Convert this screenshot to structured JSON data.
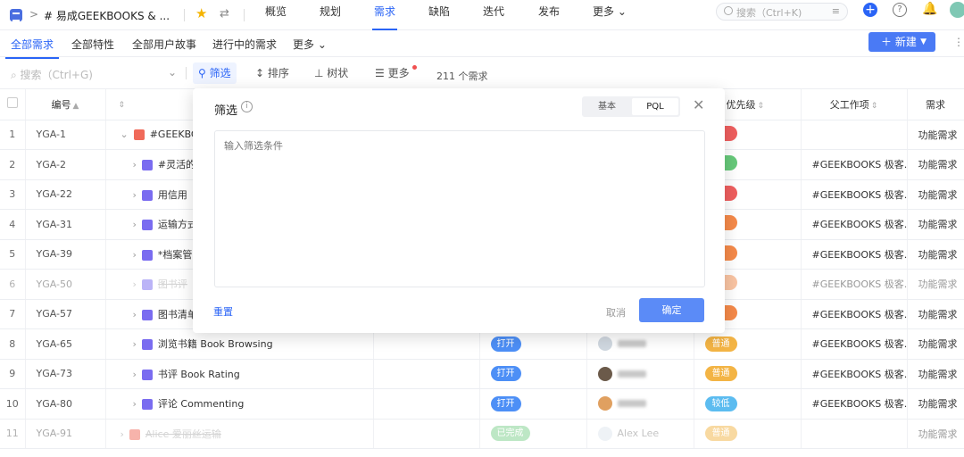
{
  "topbar": {
    "breadcrumb_sep": ">",
    "project_name": "# 易成GEEKBOOKS & ...",
    "nav": [
      "概览",
      "规划",
      "需求",
      "缺陷",
      "迭代",
      "发布",
      "更多"
    ],
    "nav_more_caret": "⌄",
    "search_placeholder": "搜索（Ctrl+K)"
  },
  "subnav": {
    "tabs": [
      "全部需求",
      "全部特性",
      "全部用户故事",
      "进行中的需求",
      "更多"
    ],
    "new_button": "新建"
  },
  "toolbar": {
    "search_placeholder": "搜索（Ctrl+G)",
    "filter": "筛选",
    "sort": "排序",
    "tree": "树状",
    "more": "更多",
    "count": "211 个需求"
  },
  "table": {
    "headers": {
      "code": "编号",
      "priority": "优先级",
      "parent": "父工作项",
      "type": "需求"
    },
    "rows": [
      {
        "n": "1",
        "code": "YGA-1",
        "title": "#GEEKBOO",
        "kind": "epic",
        "expand": "⌄",
        "status": "",
        "assignee": "",
        "prio": "",
        "prio_c": "p-red",
        "parent": "",
        "type": "功能需求",
        "faded": false
      },
      {
        "n": "2",
        "code": "YGA-2",
        "title": "#灵活的",
        "kind": "req",
        "expand": "›",
        "status": "",
        "assignee": "",
        "prio": "",
        "prio_c": "p-green",
        "parent": "#GEEKBOOKS 极客...",
        "type": "功能需求",
        "faded": false
      },
      {
        "n": "3",
        "code": "YGA-22",
        "title": "用信用",
        "kind": "req",
        "expand": "›",
        "status": "",
        "assignee": "",
        "prio": "",
        "prio_c": "p-red",
        "parent": "#GEEKBOOKS 极客...",
        "type": "功能需求",
        "faded": false
      },
      {
        "n": "4",
        "code": "YGA-31",
        "title": "运输方式",
        "kind": "req",
        "expand": "›",
        "status": "",
        "assignee": "",
        "prio": "",
        "prio_c": "p-orange",
        "parent": "#GEEKBOOKS 极客...",
        "type": "功能需求",
        "faded": false
      },
      {
        "n": "5",
        "code": "YGA-39",
        "title": "*档案管",
        "kind": "req",
        "expand": "›",
        "status": "",
        "assignee": "",
        "prio": "",
        "prio_c": "p-orange",
        "parent": "#GEEKBOOKS 极客...",
        "type": "功能需求",
        "faded": false
      },
      {
        "n": "6",
        "code": "YGA-50",
        "title": "图书评",
        "kind": "req",
        "expand": "›",
        "status": "",
        "assignee": "",
        "prio": "",
        "prio_c": "p-orange",
        "parent": "#GEEKBOOKS 极客...",
        "type": "功能需求",
        "faded": true
      },
      {
        "n": "7",
        "code": "YGA-57",
        "title": "图书清单",
        "kind": "req",
        "expand": "›",
        "status": "",
        "assignee": "",
        "prio": "",
        "prio_c": "p-orange",
        "parent": "#GEEKBOOKS 极客...",
        "type": "功能需求",
        "faded": false
      },
      {
        "n": "8",
        "code": "YGA-65",
        "title": "浏览书籍 Book Browsing",
        "kind": "req",
        "expand": "›",
        "status": "打开",
        "assignee": "blur",
        "prio": "普通",
        "prio_c": "p-yellow",
        "parent": "#GEEKBOOKS 极客...",
        "type": "功能需求",
        "faded": false
      },
      {
        "n": "9",
        "code": "YGA-73",
        "title": "书评 Book Rating",
        "kind": "req",
        "expand": "›",
        "status": "打开",
        "assignee": "blur",
        "prio": "普通",
        "prio_c": "p-yellow",
        "parent": "#GEEKBOOKS 极客...",
        "type": "功能需求",
        "faded": false
      },
      {
        "n": "10",
        "code": "YGA-80",
        "title": "评论 Commenting",
        "kind": "req",
        "expand": "›",
        "status": "打开",
        "assignee": "blur",
        "prio": "较低",
        "prio_c": "p-blue",
        "parent": "#GEEKBOOKS 极客...",
        "type": "功能需求",
        "faded": false
      },
      {
        "n": "11",
        "code": "YGA-91",
        "title": "Alice 爱丽丝运输",
        "kind": "epic",
        "expand": "›",
        "status": "已完成",
        "assignee": "Alex Lee",
        "prio": "普通",
        "prio_c": "p-yellow",
        "parent": "",
        "type": "功能需求",
        "faded": true
      }
    ]
  },
  "modal": {
    "title": "筛选",
    "info": "i",
    "mode_basic": "基本",
    "mode_pql": "PQL",
    "close": "✕",
    "placeholder": "输入筛选条件",
    "reset": "重置",
    "cancel": "取消",
    "ok": "确定"
  }
}
